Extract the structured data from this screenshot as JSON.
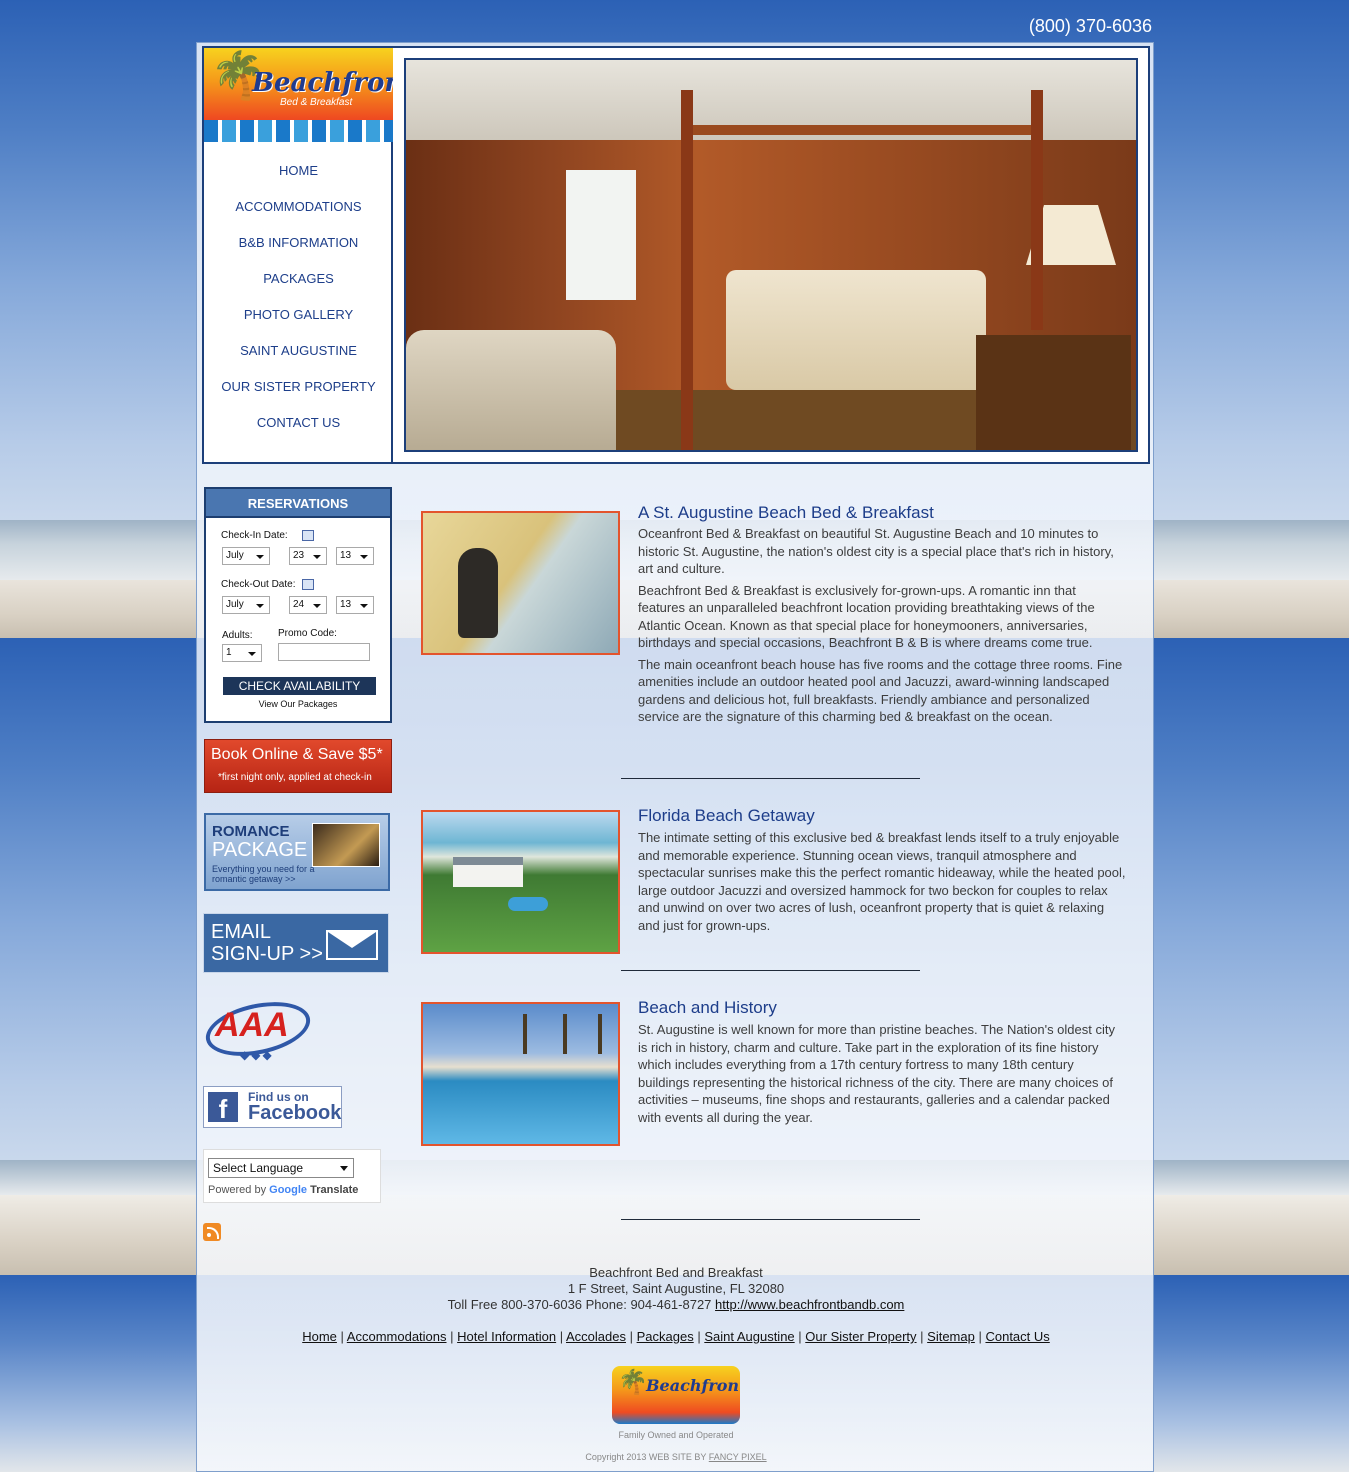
{
  "phone": "(800) 370-6036",
  "logo": {
    "title": "Beachfront",
    "subtitle": "Bed & Breakfast"
  },
  "nav": [
    "HOME",
    "ACCOMMODATIONS",
    "B&B INFORMATION",
    "PACKAGES",
    "PHOTO GALLERY",
    "SAINT AUGUSTINE",
    "OUR SISTER PROPERTY",
    "CONTACT US"
  ],
  "reservations": {
    "title": "RESERVATIONS",
    "checkin_label": "Check-In Date:",
    "checkin_month": "July",
    "checkin_day": "23",
    "checkin_year": "13",
    "checkout_label": "Check-Out Date:",
    "checkout_month": "July",
    "checkout_day": "24",
    "checkout_year": "13",
    "adults_label": "Adults:",
    "adults_value": "1",
    "promo_label": "Promo Code:",
    "promo_value": "",
    "check_button": "CHECK AVAILABILITY",
    "view_packages": "View Our Packages"
  },
  "book_banner": {
    "line1": "Book Online & Save $5*",
    "line2": "*first night only, applied at check-in"
  },
  "romance": {
    "line1": "ROMANCE",
    "line2": "PACKAGE",
    "line3": "Everything you need for a romantic getaway >>"
  },
  "email_signup": {
    "line1": "EMAIL",
    "line2": "SIGN-UP >>"
  },
  "aaa": {
    "text": "AAA",
    "diamonds": "◆◆◆"
  },
  "facebook": {
    "line1": "Find us on",
    "line2": "Facebook"
  },
  "translate": {
    "select": "Select Language",
    "powered": "Powered by",
    "google": "Google",
    "translate": "Translate"
  },
  "sections": [
    {
      "title": "A St. Augustine Beach Bed & Breakfast",
      "paragraphs": [
        "Oceanfront Bed & Breakfast on beautiful St. Augustine Beach and 10 minutes to historic St. Augustine, the nation's oldest city is a special place that's rich in history, art and culture.",
        "Beachfront Bed & Breakfast is exclusively for-grown-ups. A romantic inn that features an unparalleled beachfront location providing breathtaking views of the Atlantic Ocean. Known as that special place for honeymooners, anniversaries, birthdays and special occasions, Beachfront B & B is where dreams come true.",
        "The main oceanfront beach house has five rooms and the cottage three rooms. Fine amenities include an outdoor heated pool and Jacuzzi, award-winning landscaped gardens and delicious hot, full breakfasts. Friendly ambiance and personalized service are the signature of this charming bed & breakfast on the ocean."
      ]
    },
    {
      "title": "Florida Beach Getaway",
      "paragraphs": [
        "The intimate setting of this exclusive bed & breakfast lends itself to a truly enjoyable and memorable experience. Stunning ocean views, tranquil atmosphere and spectacular sunrises make this the perfect romantic hideaway, while the heated pool, large outdoor Jacuzzi and oversized hammock for two beckon for couples to relax and unwind on over two acres of lush, oceanfront property that is quiet & relaxing and just for grown-ups."
      ]
    },
    {
      "title": "Beach and History",
      "paragraphs": [
        "St. Augustine is well known for more than pristine beaches. The Nation's oldest city is rich in history, charm and culture. Take part in the exploration of its fine history which includes everything from a 17th century fortress to many 18th century buildings representing the historical richness of the city. There are many choices of activities – museums, fine shops and restaurants, galleries and a calendar packed with events all during the year."
      ]
    }
  ],
  "footer": {
    "name": "Beachfront Bed and Breakfast",
    "address": "1 F Street, Saint Augustine, FL 32080",
    "contact": "Toll Free 800-370-6036 Phone: 904-461-8727",
    "url": "http://www.beachfrontbandb.com",
    "links": [
      "Home",
      "Accommodations",
      "Hotel Information",
      "Accolades",
      "Packages",
      "Saint Augustine",
      "Our Sister Property",
      "Sitemap",
      "Contact Us"
    ],
    "logo_title": "Beachfront",
    "tagline": "Family Owned and Operated",
    "copyright": "Copyright 2013 WEB SITE BY",
    "designer": "FANCY PIXEL"
  }
}
